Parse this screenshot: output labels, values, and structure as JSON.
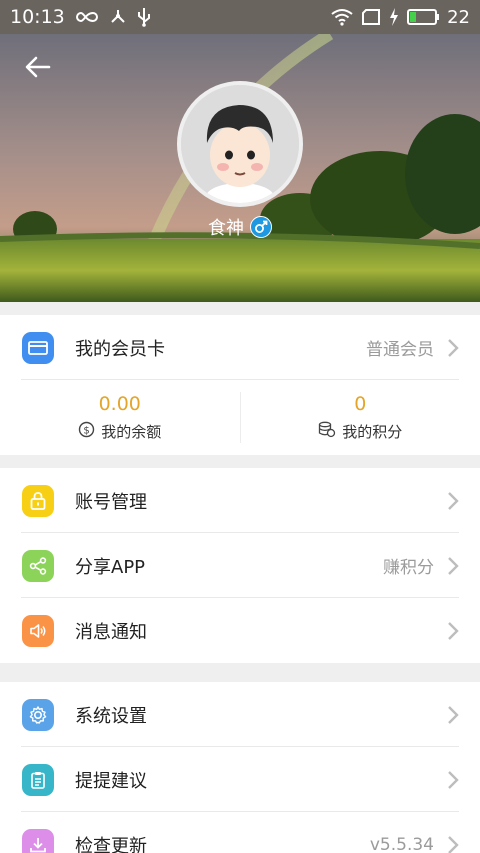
{
  "status_bar": {
    "time": "10:13",
    "battery_level": "22",
    "icons": [
      "infinity-icon",
      "share-node-icon",
      "usb-icon",
      "wifi-icon",
      "sim-icon",
      "charging-icon",
      "battery-icon"
    ]
  },
  "profile": {
    "nickname": "食神",
    "gender_icon": "male-icon",
    "accent_color": "#1e98e0"
  },
  "membership": {
    "label": "我的会员卡",
    "value": "普通会员",
    "icon": "card-icon",
    "icon_color": "#3f8ef0"
  },
  "stats": {
    "balance": {
      "value": "0.00",
      "label": "我的余额",
      "icon": "coin-icon"
    },
    "points": {
      "value": "0",
      "label": "我的积分",
      "icon": "stack-icon"
    },
    "value_color": "#e5a52a"
  },
  "menu_group_1": [
    {
      "label": "账号管理",
      "value": "",
      "icon": "lock-icon",
      "icon_color": "#f7cf14"
    },
    {
      "label": "分享APP",
      "value": "赚积分",
      "icon": "share-icon",
      "icon_color": "#8cd35a"
    },
    {
      "label": "消息通知",
      "value": "",
      "icon": "speaker-icon",
      "icon_color": "#fb9347"
    }
  ],
  "menu_group_2": [
    {
      "label": "系统设置",
      "value": "",
      "icon": "gear-icon",
      "icon_color": "#5ba3e8"
    },
    {
      "label": "提提建议",
      "value": "",
      "icon": "clipboard-icon",
      "icon_color": "#36b6c8"
    },
    {
      "label": "检查更新",
      "value": "v5.5.34",
      "icon": "download-icon",
      "icon_color": "#dd8ee8"
    }
  ]
}
